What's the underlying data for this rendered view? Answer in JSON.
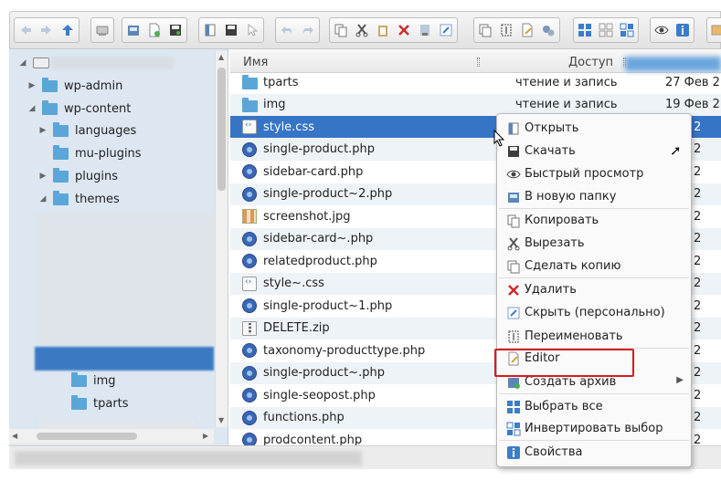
{
  "sidebar": {
    "tree": [
      {
        "label": "wp-admin"
      },
      {
        "label": "wp-content"
      },
      {
        "label": "languages"
      },
      {
        "label": "mu-plugins"
      },
      {
        "label": "plugins"
      },
      {
        "label": "themes"
      },
      {
        "label": "img"
      },
      {
        "label": "tparts"
      }
    ]
  },
  "filelist": {
    "headers": {
      "name": "Имя",
      "access": "Доступ"
    },
    "rows": [
      {
        "name": "tparts",
        "access": "чтение и запись",
        "date": "27 Фев 2",
        "icon": "folder-icon"
      },
      {
        "name": "img",
        "access": "чтение и запись",
        "date": "19 Фев 2",
        "icon": "folder-icon"
      },
      {
        "name": "style.css",
        "access": "",
        "date": "Фев 2",
        "icon": "css-file-icon"
      },
      {
        "name": "single-product.php",
        "access": "",
        "date": "Фев 2",
        "icon": "php-file-icon"
      },
      {
        "name": "sidebar-card.php",
        "access": "",
        "date": "Фев 2",
        "icon": "php-file-icon"
      },
      {
        "name": "single-product~2.php",
        "access": "",
        "date": "Фев 2",
        "icon": "php-file-icon"
      },
      {
        "name": "screenshot.jpg",
        "access": "",
        "date": "Фев 2",
        "icon": "image-file-icon"
      },
      {
        "name": "sidebar-card~.php",
        "access": "",
        "date": "Фев 2",
        "icon": "php-file-icon"
      },
      {
        "name": "relatedproduct.php",
        "access": "",
        "date": "Фев 2",
        "icon": "php-file-icon"
      },
      {
        "name": "style~.css",
        "access": "",
        "date": "Фев 2",
        "icon": "css-file-icon"
      },
      {
        "name": "single-product~1.php",
        "access": "",
        "date": "Фев 2",
        "icon": "php-file-icon"
      },
      {
        "name": "DELETE.zip",
        "access": "",
        "date": "Фев 2",
        "icon": "zip-file-icon"
      },
      {
        "name": "taxonomy-producttype.php",
        "access": "",
        "date": "Фев 2",
        "icon": "php-file-icon"
      },
      {
        "name": "single-product~.php",
        "access": "",
        "date": "Фев 2",
        "icon": "php-file-icon"
      },
      {
        "name": "single-seopost.php",
        "access": "",
        "date": "Фев 2",
        "icon": "php-file-icon"
      },
      {
        "name": "functions.php",
        "access": "",
        "date": "Фев 2",
        "icon": "php-file-icon"
      },
      {
        "name": "prodcontent.php",
        "access": "",
        "date": "Фев 2",
        "icon": "php-file-icon"
      }
    ]
  },
  "context_menu": {
    "items": [
      {
        "label": "Открыть",
        "icon": "open-icon"
      },
      {
        "label": "Скачать",
        "icon": "download-icon"
      },
      {
        "label": "Быстрый просмотр",
        "icon": "eye-icon"
      },
      {
        "label": "В новую папку",
        "icon": "new-folder-icon"
      },
      {
        "label": "Копировать",
        "icon": "copy-icon"
      },
      {
        "label": "Вырезать",
        "icon": "cut-icon"
      },
      {
        "label": "Сделать копию",
        "icon": "duplicate-icon"
      },
      {
        "label": "Удалить",
        "icon": "delete-icon"
      },
      {
        "label": "Скрыть (персонально)",
        "icon": "hide-icon"
      },
      {
        "label": "Переименовать",
        "icon": "rename-icon"
      },
      {
        "label": "Editor",
        "icon": "edit-icon"
      },
      {
        "label": "Создать архив",
        "icon": "archive-icon"
      },
      {
        "label": "Выбрать все",
        "icon": "select-all-icon"
      },
      {
        "label": "Инвертировать выбор",
        "icon": "invert-selection-icon"
      },
      {
        "label": "Свойства",
        "icon": "info-icon"
      }
    ]
  },
  "colors": {
    "accent": "#3675c6",
    "sidebar_bg": "#dce7f1",
    "highlight_box": "#d61b22"
  }
}
